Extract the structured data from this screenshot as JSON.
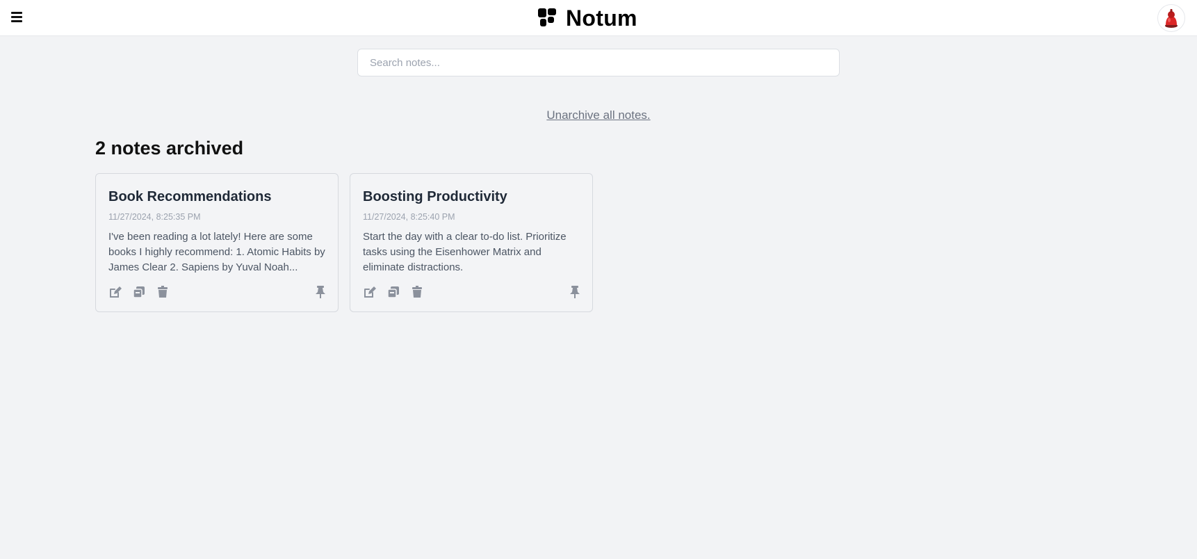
{
  "app": {
    "name": "Notum"
  },
  "header": {
    "menu_icon": "hamburger-icon",
    "logo_icon": "grid-blocks-icon",
    "avatar_icon": "user-avatar-icon"
  },
  "search": {
    "placeholder": "Search notes...",
    "value": ""
  },
  "archive": {
    "unarchive_label": "Unarchive all notes.",
    "count_label": "2 notes archived"
  },
  "notes": [
    {
      "title": "Book Recommendations",
      "date": "11/27/2024, 8:25:35 PM",
      "body": "I've been reading a lot lately! Here are some books I highly recommend: 1. Atomic Habits by James Clear 2. Sapiens by Yuval Noah..."
    },
    {
      "title": "Boosting Productivity",
      "date": "11/27/2024, 8:25:40 PM",
      "body": "Start the day with a clear to-do list. Prioritize tasks using the Eisenhower Matrix and eliminate distractions."
    }
  ],
  "note_actions": [
    "edit-icon",
    "duplicate-icon",
    "trash-icon",
    "pin-icon"
  ],
  "colors": {
    "background": "#f2f3f5",
    "header": "#ffffff",
    "card": "#f3f4f6",
    "icon": "#8b919c",
    "muted_text": "#6b7280"
  }
}
